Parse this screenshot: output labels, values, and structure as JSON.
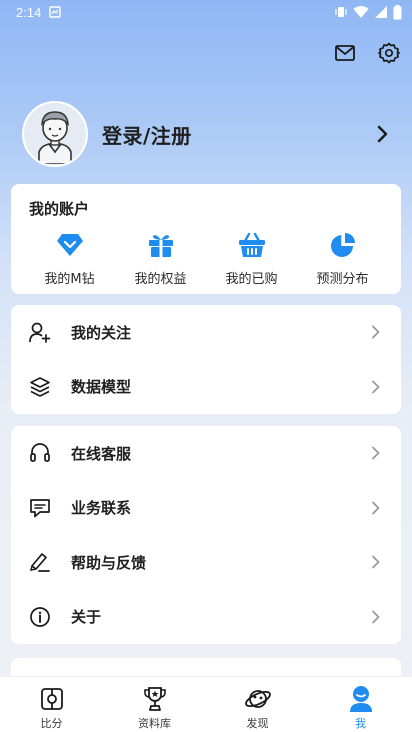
{
  "status_bar": {
    "time": "2:14"
  },
  "profile": {
    "login_label": "登录/注册"
  },
  "account": {
    "title": "我的账户",
    "items": [
      {
        "label": "我的M钻",
        "icon": "diamond-icon"
      },
      {
        "label": "我的权益",
        "icon": "gift-icon"
      },
      {
        "label": "我的已购",
        "icon": "basket-icon"
      },
      {
        "label": "预测分布",
        "icon": "pie-chart-icon"
      }
    ]
  },
  "menu_group_1": [
    {
      "label": "我的关注",
      "icon": "add-user-icon"
    },
    {
      "label": "数据模型",
      "icon": "layers-icon"
    }
  ],
  "menu_group_2": [
    {
      "label": "在线客服",
      "icon": "headset-icon"
    },
    {
      "label": "业务联系",
      "icon": "message-icon"
    },
    {
      "label": "帮助与反馈",
      "icon": "feedback-pen-icon"
    },
    {
      "label": "关于",
      "icon": "info-icon"
    }
  ],
  "tabs": [
    {
      "label": "比分",
      "icon": "score-icon",
      "active": false
    },
    {
      "label": "资料库",
      "icon": "trophy-icon",
      "active": false
    },
    {
      "label": "发现",
      "icon": "planet-icon",
      "active": false
    },
    {
      "label": "我",
      "icon": "profile-icon",
      "active": true
    }
  ],
  "colors": {
    "accent": "#1f8cf0",
    "header_gradient_top": "#8fb7f4"
  }
}
